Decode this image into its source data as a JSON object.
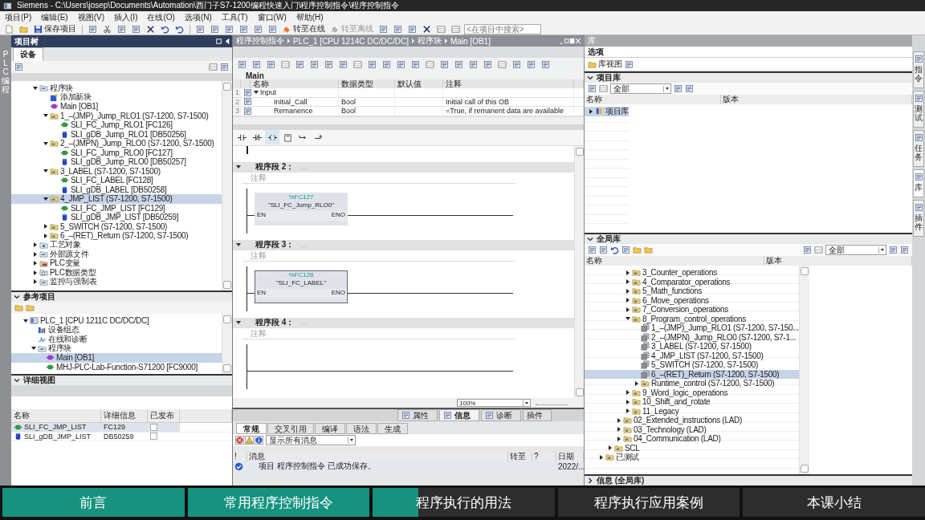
{
  "window": {
    "title": "Siemens  -  C:\\Users\\josep\\Documents\\Automation\\西门子S7-1200编程快速入门\\程序控制指令\\程序控制指令"
  },
  "menu": [
    "项目(P)",
    "编辑(E)",
    "视图(V)",
    "插入(I)",
    "在线(O)",
    "选项(N)",
    "工具(T)",
    "窗口(W)",
    "帮助(H)"
  ],
  "toolbar": {
    "save": "保存项目",
    "go_online": {
      "label": "转至在线",
      "disabled": false
    },
    "go_offline": {
      "label": "转至离线",
      "disabled": true
    },
    "search": {
      "placeholder": "<在项目中搜索>"
    }
  },
  "side_tab": "PLC 编程",
  "project_tree": {
    "title": "项目树",
    "tabs": [
      {
        "label": "设备",
        "selected": true
      }
    ],
    "items": [
      {
        "label": "程序块",
        "kind": "program",
        "expanded": true,
        "selected": false,
        "children": [
          {
            "label": "添加新块",
            "kind": "add",
            "selected": false
          },
          {
            "label": "Main [OB1]",
            "kind": "ob",
            "selected": false
          },
          {
            "label": "1_–(JMP)_Jump_RLO1 (S7-1200, S7-1500)",
            "kind": "folder",
            "expanded": true,
            "selected": false,
            "children": [
              {
                "label": "SLI_FC_Jump_RLO1 [FC126]",
                "kind": "fc",
                "selected": false
              },
              {
                "label": "SLI_gDB_Jump_RLO1 [DB50256]",
                "kind": "db",
                "selected": false
              }
            ]
          },
          {
            "label": "2_–(JMPN)_Jump_RLO0 (S7-1200, S7-1500)",
            "kind": "folder",
            "expanded": true,
            "selected": false,
            "children": [
              {
                "label": "SLI_FC_Jump_RLO0 [FC127]",
                "kind": "fc",
                "selected": false
              },
              {
                "label": "SLI_gDB_Jump_RLO0 [DB50257]",
                "kind": "db",
                "selected": false
              }
            ]
          },
          {
            "label": "3_LABEL (S7-1200, S7-1500)",
            "kind": "folder",
            "expanded": true,
            "selected": false,
            "children": [
              {
                "label": "SLI_FC_LABEL [FC128]",
                "kind": "fc",
                "selected": false
              },
              {
                "label": "SLI_gDB_LABEL [DB50258]",
                "kind": "db",
                "selected": false
              }
            ]
          },
          {
            "label": "4_JMP_LIST (S7-1200, S7-1500)",
            "kind": "folder",
            "expanded": true,
            "selected": true,
            "children": [
              {
                "label": "SLI_FC_JMP_LIST [FC129]",
                "kind": "fc",
                "selected": false
              },
              {
                "label": "SLI_gDB_JMP_LIST [DB50259]",
                "kind": "db",
                "selected": false
              }
            ]
          },
          {
            "label": "5_SWITCH (S7-1200, S7-1500)",
            "kind": "folder",
            "expanded": false,
            "selected": false
          },
          {
            "label": "6_–(RET)_Return (S7-1200, S7-1500)",
            "kind": "folder",
            "expanded": false,
            "selected": false
          }
        ]
      },
      {
        "label": "工艺对象",
        "kind": "tech",
        "expanded": false,
        "selected": false
      },
      {
        "label": "外部源文件",
        "kind": "program",
        "expanded": false,
        "selected": false
      },
      {
        "label": "PLC变量",
        "kind": "tags",
        "expanded": false,
        "selected": false
      },
      {
        "label": "PLC数据类型",
        "kind": "types",
        "expanded": false,
        "selected": false
      },
      {
        "label": "监控与强制表",
        "kind": "program",
        "expanded": false,
        "selected": false
      }
    ]
  },
  "reference_projects": {
    "title": "参考项目",
    "expanded": true,
    "items": [
      {
        "label": "PLC_1 [CPU 1211C DC/DC/DC]",
        "kind": "cpu",
        "expanded": true,
        "selected": false,
        "children": [
          {
            "label": "设备组态",
            "kind": "config",
            "selected": false
          },
          {
            "label": "在线和诊断",
            "kind": "online",
            "selected": false
          },
          {
            "label": "程序块",
            "kind": "program",
            "expanded": true,
            "selected": false,
            "children": [
              {
                "label": "Main [OB1]",
                "kind": "ob",
                "selected": true
              },
              {
                "label": "MHJ-PLC-Lab-Function-S71200 [FC9000]",
                "kind": "fc",
                "selected": false
              }
            ]
          }
        ]
      }
    ]
  },
  "details_view": {
    "title": "详细视图",
    "expanded": true,
    "columns": [
      "名称",
      "详细信息",
      "已发布"
    ],
    "rows": [
      {
        "kind": "fc",
        "name": "SLI_FC_JMP_LIST",
        "detail": "FC129",
        "published": false,
        "selected": true
      },
      {
        "kind": "db",
        "name": "SLI_gDB_JMP_LIST",
        "detail": "DB50259",
        "published": false,
        "selected": false
      }
    ]
  },
  "editor": {
    "breadcrumb": [
      "程序控制指令",
      "PLC_1 [CPU 1214C DC/DC/DC]",
      "程序块",
      "Main [OB1]"
    ],
    "block_name": "Main",
    "interface": {
      "columns": [
        "名称",
        "数据类型",
        "默认值",
        "注释"
      ],
      "rows": [
        {
          "number": "1",
          "name": "Input",
          "expanded": true
        },
        {
          "number": "2",
          "name": "Initial_Call",
          "type": "Bool",
          "comment": "Initial call of this OB"
        },
        {
          "number": "3",
          "name": "Remanence",
          "type": "Bool",
          "comment": "=True, if remanent data are available"
        }
      ]
    },
    "networks": [
      {
        "title": "程序段 2：",
        "dots": "....",
        "comment": "注释",
        "block": {
          "address": "%FC127",
          "name": "\"SLI_FC_Jump_RLO0\"",
          "en": "EN",
          "eno": "ENO",
          "selected": false
        }
      },
      {
        "title": "程序段 3：",
        "dots": "....",
        "comment": "注释",
        "block": {
          "address": "%FC128",
          "name": "\"SLI_FC_LABEL\"",
          "en": "EN",
          "eno": "ENO",
          "selected": true
        }
      },
      {
        "title": "程序段 4：",
        "dots": "....",
        "comment": "注释"
      }
    ],
    "zoom": "100%"
  },
  "inspector": {
    "tabs": [
      {
        "label": "属性",
        "selected": false
      },
      {
        "label": "信息",
        "selected": true
      },
      {
        "label": "诊断",
        "selected": false
      },
      {
        "label": "插件",
        "selected": false
      }
    ],
    "subtabs": [
      {
        "label": "常规",
        "selected": true
      },
      {
        "label": "交叉引用",
        "selected": false
      },
      {
        "label": "编译",
        "selected": false
      },
      {
        "label": "语法",
        "selected": false
      },
      {
        "label": "生成",
        "selected": false
      }
    ],
    "filter": "显示所有消息",
    "columns": [
      "!",
      "消息",
      "转至",
      "?",
      "日期"
    ],
    "messages": [
      {
        "text": "项目 程序控制指令 已成功保存。",
        "date": "2022/..."
      }
    ]
  },
  "library": {
    "title": "库",
    "options": "选项",
    "library_view": "库视图",
    "project_library": {
      "title": "项目库",
      "expanded": true,
      "filter": "全部",
      "columns": [
        "名称",
        "版本"
      ],
      "items": [
        {
          "label": "项目库",
          "kind": "library",
          "expanded": false,
          "selected": true
        }
      ]
    },
    "global_library": {
      "title": "全局库",
      "expanded": true,
      "filter": "全部",
      "columns": [
        "名称",
        "版本"
      ],
      "items": [
        {
          "children": [
            {
              "children": [
                {
                  "children": [
                    {
                      "label": "3_Counter_operations",
                      "kind": "folder",
                      "expanded": false,
                      "selected": false
                    },
                    {
                      "label": "4_Comparator_operations",
                      "kind": "folder",
                      "expanded": false,
                      "selected": false
                    },
                    {
                      "label": "5_Math_functions",
                      "kind": "folder",
                      "expanded": false,
                      "selected": false
                    },
                    {
                      "label": "6_Move_operations",
                      "kind": "folder",
                      "expanded": false,
                      "selected": false
                    },
                    {
                      "label": "7_Conversion_operations",
                      "kind": "folder",
                      "expanded": false,
                      "selected": false
                    },
                    {
                      "label": "8_Program_control_operations",
                      "kind": "folder",
                      "expanded": true,
                      "selected": false,
                      "children": [
                        {
                          "label": "1_–(JMP)_Jump_RLO1 (S7-1200, S7-150...",
                          "kind": "template",
                          "selected": false
                        },
                        {
                          "label": "2_–(JMPN)_Jump_RLO0 (S7-1200, S7-1...",
                          "kind": "template",
                          "selected": false
                        },
                        {
                          "label": "3_LABEL (S7-1200, S7-1500)",
                          "kind": "template",
                          "selected": false
                        },
                        {
                          "label": "4_JMP_LIST (S7-1200, S7-1500)",
                          "kind": "template",
                          "selected": false
                        },
                        {
                          "label": "5_SWITCH (S7-1200, S7-1500)",
                          "kind": "template",
                          "selected": false
                        },
                        {
                          "label": "6_–(RET)_Return (S7-1200, S7-1500)",
                          "kind": "template",
                          "selected": true
                        },
                        {
                          "label": "Runtime_control (S7-1200, S7-1500)",
                          "kind": "folder",
                          "expanded": false,
                          "selected": false
                        }
                      ]
                    },
                    {
                      "label": "9_Word_logic_operations",
                      "kind": "folder",
                      "expanded": false,
                      "selected": false
                    },
                    {
                      "label": "10_Shift_and_rotate",
                      "kind": "folder",
                      "expanded": false,
                      "selected": false
                    },
                    {
                      "label": "11_Legacy",
                      "kind": "folder",
                      "expanded": false,
                      "selected": false
                    }
                  ]
                },
                {
                  "label": "02_Extended_instructions (LAD)",
                  "kind": "folder",
                  "expanded": false,
                  "selected": false
                },
                {
                  "label": "03_Technology (LAD)",
                  "kind": "folder",
                  "expanded": false,
                  "selected": false
                },
                {
                  "label": "04_Communication (LAD)",
                  "kind": "folder",
                  "expanded": false,
                  "selected": false
                }
              ]
            },
            {
              "label": "SCL",
              "kind": "folder",
              "expanded": false,
              "selected": false
            }
          ]
        },
        {
          "label": "已测试",
          "kind": "folder",
          "expanded": false,
          "selected": false
        }
      ]
    },
    "info": {
      "title": "信息 (全局库)",
      "expanded": false
    }
  },
  "right_tabs": [
    {
      "label": "指令",
      "selected": false
    },
    {
      "label": "测试",
      "selected": false
    },
    {
      "label": "任务",
      "selected": false
    },
    {
      "label": "库",
      "selected": true
    },
    {
      "label": "插件",
      "selected": false
    }
  ],
  "lessons": [
    {
      "label": "前言",
      "level": 1
    },
    {
      "label": "常用程序控制指令",
      "level": 1
    },
    {
      "label": "程序执行的用法",
      "level": 0.25
    },
    {
      "label": "程序执行应用案例",
      "level": 0
    },
    {
      "label": "本课小结",
      "level": 0
    }
  ]
}
